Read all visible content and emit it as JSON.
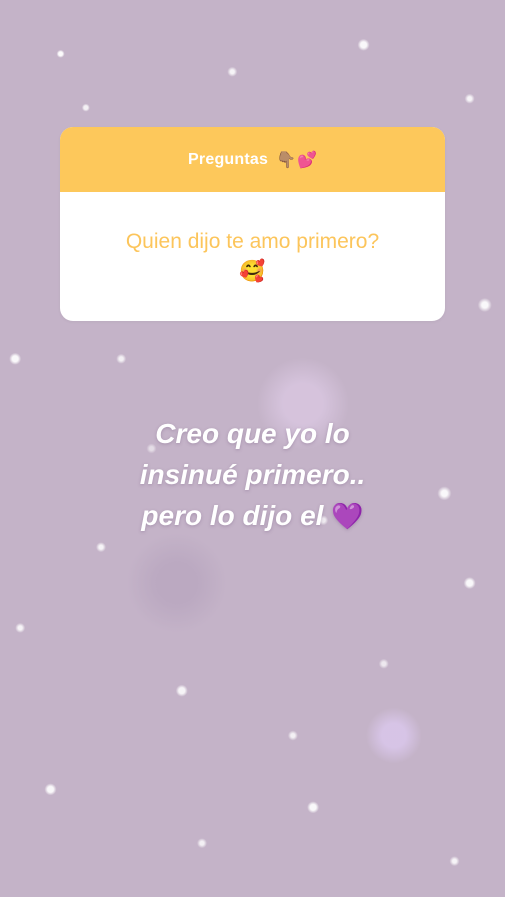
{
  "background": {
    "description_color": "#c4b3c8"
  },
  "question_sticker": {
    "header_title": "Preguntas",
    "header_emojis": [
      "👇🏽",
      "💕"
    ],
    "question": "Quien dijo te amo primero?",
    "question_emoji": "🥰",
    "colors": {
      "header": "#fdc85b",
      "question_text": "#fcc55b"
    }
  },
  "answer": {
    "line1": "Creo que yo lo",
    "line2": "insinué primero..",
    "line3": "pero lo dijo el",
    "line3_emoji": "💜"
  }
}
